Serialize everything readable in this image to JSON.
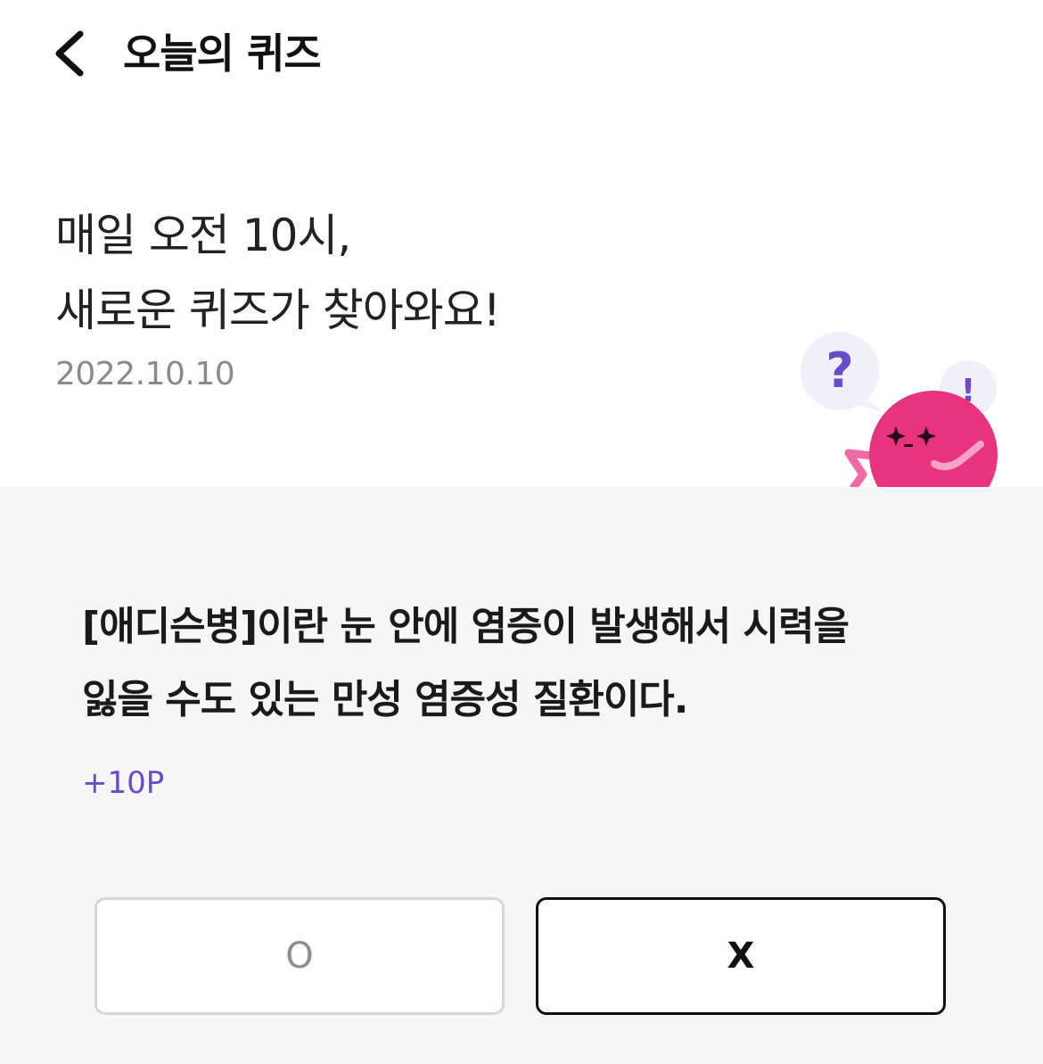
{
  "header": {
    "title": "오늘의 퀴즈",
    "back_icon": "chevron-left-icon"
  },
  "intro": {
    "line1": "매일 오전 10시,",
    "line2": "새로운 퀴즈가 찾아와요!",
    "date": "2022.10.10"
  },
  "mascot": {
    "question_mark": "?",
    "exclamation_mark": "!",
    "body_color": "#e8337f",
    "bubble_color": "#f1f0f8",
    "mark_color": "#6a4cc8"
  },
  "quiz": {
    "question_line1": "[애디슨병]이란 눈 안에 염증이 발생해서 시력을",
    "question_line2": "잃을 수도 있는 만성 염증성 질환이다.",
    "points": "+10P"
  },
  "answers": {
    "o_label": "O",
    "x_label": "X"
  },
  "colors": {
    "accent": "#6a4cc8",
    "background": "#f6f6f6",
    "top_background": "#ffffff"
  }
}
